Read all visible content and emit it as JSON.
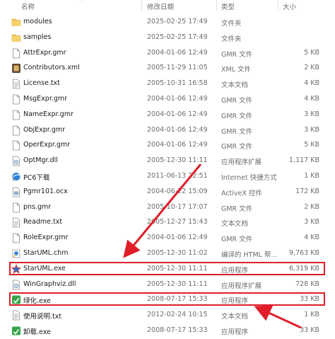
{
  "header": {
    "name": "名称",
    "date": "修改日期",
    "type": "类型",
    "size": "大小",
    "sort_indicator": "^"
  },
  "files": [
    {
      "name": "modules",
      "date": "2025-02-25 17:49",
      "type": "文件夹",
      "size": "",
      "icon": "folder-icon"
    },
    {
      "name": "samples",
      "date": "2025-02-25 17:49",
      "type": "文件夹",
      "size": "",
      "icon": "folder-icon"
    },
    {
      "name": "AttrExpr.gmr",
      "date": "2004-01-06 12:49",
      "type": "GMR 文件",
      "size": "5 KB",
      "icon": "file-icon"
    },
    {
      "name": "Contributors.xml",
      "date": "2005-11-29 11:05",
      "type": "XML 文件",
      "size": "2 KB",
      "icon": "xml-icon"
    },
    {
      "name": "License.txt",
      "date": "2005-10-31 16:58",
      "type": "文本文档",
      "size": "4 KB",
      "icon": "text-file-icon"
    },
    {
      "name": "MsgExpr.gmr",
      "date": "2004-01-06 12:49",
      "type": "GMR 文件",
      "size": "4 KB",
      "icon": "file-icon"
    },
    {
      "name": "NameExpr.gmr",
      "date": "2004-01-06 12:49",
      "type": "GMR 文件",
      "size": "3 KB",
      "icon": "file-icon"
    },
    {
      "name": "ObjExpr.gmr",
      "date": "2004-01-06 12:49",
      "type": "GMR 文件",
      "size": "3 KB",
      "icon": "file-icon"
    },
    {
      "name": "OperExpr.gmr",
      "date": "2004-01-06 12:49",
      "type": "GMR 文件",
      "size": "5 KB",
      "icon": "file-icon"
    },
    {
      "name": "OptMgr.dll",
      "date": "2005-12-30 11:11",
      "type": "应用程序扩展",
      "size": "1,117 KB",
      "icon": "dll-icon"
    },
    {
      "name": "PC6下载",
      "date": "2011-06-13 22:51",
      "type": "Internet 快捷方式",
      "size": "1 KB",
      "icon": "internet-shortcut-icon"
    },
    {
      "name": "Pgmr101.ocx",
      "date": "2004-06-22 15:09",
      "type": "ActiveX 控件",
      "size": "172 KB",
      "icon": "ocx-icon"
    },
    {
      "name": "pns.gmr",
      "date": "2005-10-17 17:07",
      "type": "GMR 文件",
      "size": "2 KB",
      "icon": "file-icon"
    },
    {
      "name": "Readme.txt",
      "date": "2005-12-27 15:43",
      "type": "文本文档",
      "size": "3 KB",
      "icon": "text-file-icon"
    },
    {
      "name": "RoleExpr.gmr",
      "date": "2004-01-06 12:49",
      "type": "GMR 文件",
      "size": "4 KB",
      "icon": "file-icon"
    },
    {
      "name": "StarUML.chm",
      "date": "2005-12-30 11:02",
      "type": "编译的 HTML 帮...",
      "size": "9,763 KB",
      "icon": "chm-icon"
    },
    {
      "name": "StarUML.exe",
      "date": "2005-12-30 11:11",
      "type": "应用程序",
      "size": "6,319 KB",
      "icon": "staruml-icon"
    },
    {
      "name": "WinGraphviz.dll",
      "date": "2005-12-30 11:11",
      "type": "应用程序扩展",
      "size": "728 KB",
      "icon": "dll-icon"
    },
    {
      "name": "绿化.exe",
      "date": "2008-07-17 15:33",
      "type": "应用程序",
      "size": "33 KB",
      "icon": "green-exe-icon"
    },
    {
      "name": "使用说明.txt",
      "date": "2012-02-24 10:15",
      "type": "文本文档",
      "size": "1 KB",
      "icon": "text-file-icon"
    },
    {
      "name": "卸载.exe",
      "date": "2008-07-17 15:33",
      "type": "应用程序",
      "size": "33 KB",
      "icon": "green-exe-icon"
    }
  ],
  "highlights": [
    "StarUML.exe",
    "绿化.exe"
  ],
  "colors": {
    "highlight_border": "#e01e2a",
    "arrow": "#e01e2a",
    "folder": "#f2c14e",
    "text_secondary": "#6d6d6d"
  }
}
